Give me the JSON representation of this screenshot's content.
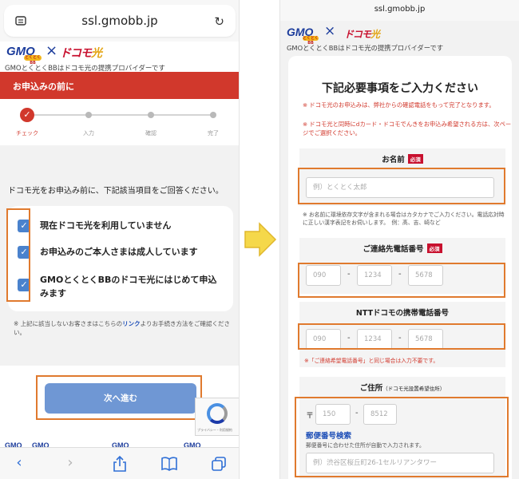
{
  "left": {
    "url": "ssl.gmobb.jp",
    "brand": {
      "gmo": "GMO",
      "gmo_sub": "とくとくBB",
      "docomo": "ドコモ",
      "hikari": "光",
      "tagline": "GMOとくとくBBはドコモ光の提携プロバイダーです"
    },
    "header": "お申込みの前に",
    "steps": [
      "チェック",
      "入力",
      "確認",
      "完了"
    ],
    "question": "ドコモ光をお申込み前に、下記該当項目をご回答ください。",
    "checklist": [
      {
        "text": "現在ドコモ光を利用していません",
        "checked": true
      },
      {
        "text": "お申込みのご本人さまは成人しています",
        "checked": true
      },
      {
        "text": "GMOとくとくBBのドコモ光にはじめて申込みます",
        "checked": true
      }
    ],
    "note_before": "※ 上記に該当しないお客さまはこちらの",
    "note_link": "リンク",
    "note_after": "よりお手続き方法をご確認ください。",
    "next_button": "次へ進む",
    "recaptcha": "プライバシー・利用規約",
    "check_glyph": "✓"
  },
  "right": {
    "url": "ssl.gmobb.jp",
    "brand": {
      "gmo": "GMO",
      "gmo_sub": "とくとくBB",
      "docomo": "ドコモ",
      "hikari": "光",
      "tagline": "GMOとくとくBBはドコモ光の提携プロバイダーです"
    },
    "title": "下記必要事項をご入力ください",
    "notices": [
      "※ ドコモ光のお申込みは、弊社からの確認電話をもって完了となります。",
      "※ ドコモ光と同時にdカード・ドコモでんきをお申込み希望される方は、次ページでご選択ください。"
    ],
    "required_badge": "必須",
    "name": {
      "label": "お名前",
      "placeholder": "例）とくとく太郎",
      "help": "※ お名前に環境依存文字が含まれる場合はカタカナでご入力ください。電話応対時に正しい漢字表記をお伺いします。　例：髙、吉、崎など"
    },
    "contact": {
      "label": "ご連絡先電話番号",
      "p1": "090",
      "p2": "1234",
      "p3": "5678"
    },
    "ntt": {
      "label": "NTTドコモの携帯電話番号",
      "p1": "090",
      "p2": "1234",
      "p3": "5678",
      "help": "※「ご連絡希望電話番号」と同じ場合は入力不要です。"
    },
    "address": {
      "label": "ご住所",
      "label_note": "（ドコモ光設置希望住所）",
      "zip_mark": "〒",
      "zip1": "150",
      "zip2": "8512",
      "zip_search": "郵便番号検索",
      "zip_help": "郵便番号に合わせた住所が自動で入力されます。",
      "address_placeholder": "例）渋谷区桜丘町26-1セルリアンタワー"
    },
    "dash": "-"
  },
  "colors": {
    "accent_red": "#d1382c",
    "highlight_orange": "#e07a2e",
    "link_blue": "#1e4fb7",
    "button_blue": "#6f97d4",
    "checkbox_blue": "#4a82cd"
  }
}
